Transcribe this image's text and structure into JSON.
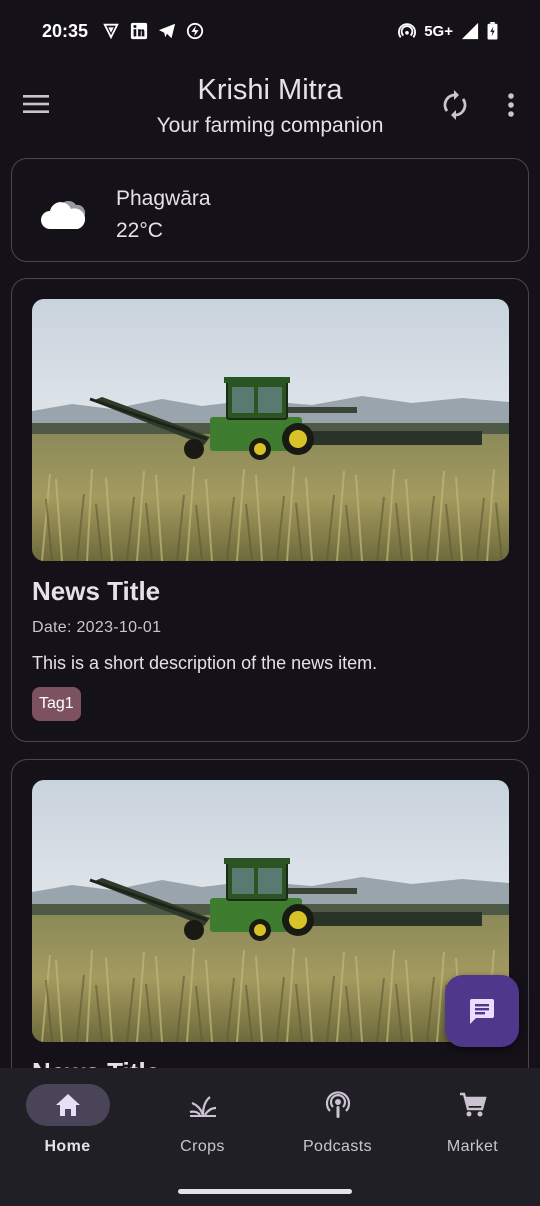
{
  "status_bar": {
    "time": "20:35",
    "network": "5G+",
    "notification_icons": [
      "vpn-icon",
      "linkedin-icon",
      "telegram-icon",
      "lightning-icon"
    ],
    "system_icons": [
      "hotspot-icon",
      "signal-icon",
      "battery-icon"
    ]
  },
  "app_bar": {
    "title": "Krishi Mitra",
    "subtitle": "Your farming companion",
    "icons": [
      "menu-icon",
      "refresh-icon",
      "more-vert-icon"
    ]
  },
  "weather": {
    "location": "Phagwāra",
    "temperature": "22°C",
    "icon": "cloud-icon"
  },
  "news": [
    {
      "title": "News Title",
      "date": "Date: 2023-10-01",
      "description": "This is a short description of the news item.",
      "tag": "Tag1",
      "image": "tractor-in-wheat-field"
    },
    {
      "title": "News Title",
      "image": "tractor-in-wheat-field"
    }
  ],
  "fab": {
    "icon": "chat-icon"
  },
  "bottom_nav": {
    "items": [
      {
        "label": "Home",
        "icon": "home-icon",
        "active": true
      },
      {
        "label": "Crops",
        "icon": "sprout-icon",
        "active": false
      },
      {
        "label": "Podcasts",
        "icon": "podcast-icon",
        "active": false
      },
      {
        "label": "Market",
        "icon": "cart-icon",
        "active": false
      }
    ]
  },
  "colors": {
    "background": "#141218",
    "surface_container": "#211f26",
    "outline": "#49454f",
    "primary_container": "#4f378b",
    "active_indicator": "#4a4458",
    "tag": "#7d5260"
  }
}
